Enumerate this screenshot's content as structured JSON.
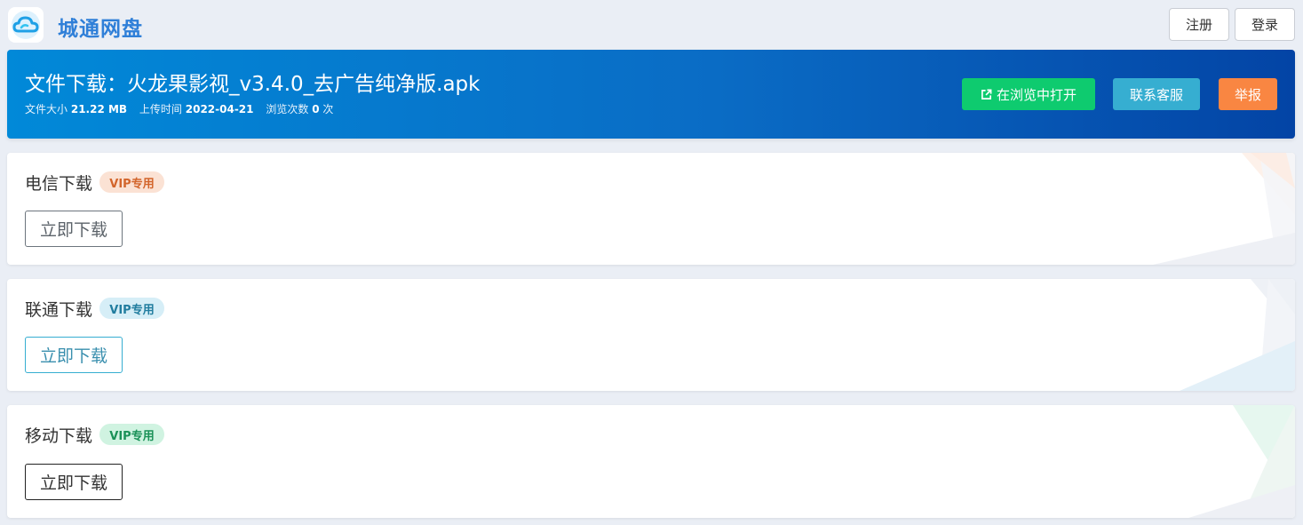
{
  "header": {
    "site_name": "城通网盘",
    "logo_icon": "cloud-icon",
    "register_label": "注册",
    "login_label": "登录"
  },
  "file": {
    "title": "文件下载：火龙果影视_v3.4.0_去广告纯净版.apk",
    "size_label": "文件大小",
    "size_value": "21.22 MB",
    "upload_label": "上传时间",
    "upload_value": "2022-04-21",
    "views_label": "浏览次数",
    "views_value": "0",
    "views_unit": "次"
  },
  "actions": {
    "open_in_browser": "在浏览中打开",
    "open_icon": "external-link-icon",
    "contact_service": "联系客服",
    "report": "举报"
  },
  "downloads": [
    {
      "title": "电信下载",
      "badge": "VIP专用",
      "button": "立即下载"
    },
    {
      "title": "联通下载",
      "badge": "VIP专用",
      "button": "立即下载"
    },
    {
      "title": "移动下载",
      "badge": "VIP专用",
      "button": "立即下载"
    }
  ],
  "colors": {
    "brand": "#2f7fd8",
    "open_btn": "#0ecb6f",
    "service_btn": "#36aed1",
    "report_btn": "#f98642"
  }
}
